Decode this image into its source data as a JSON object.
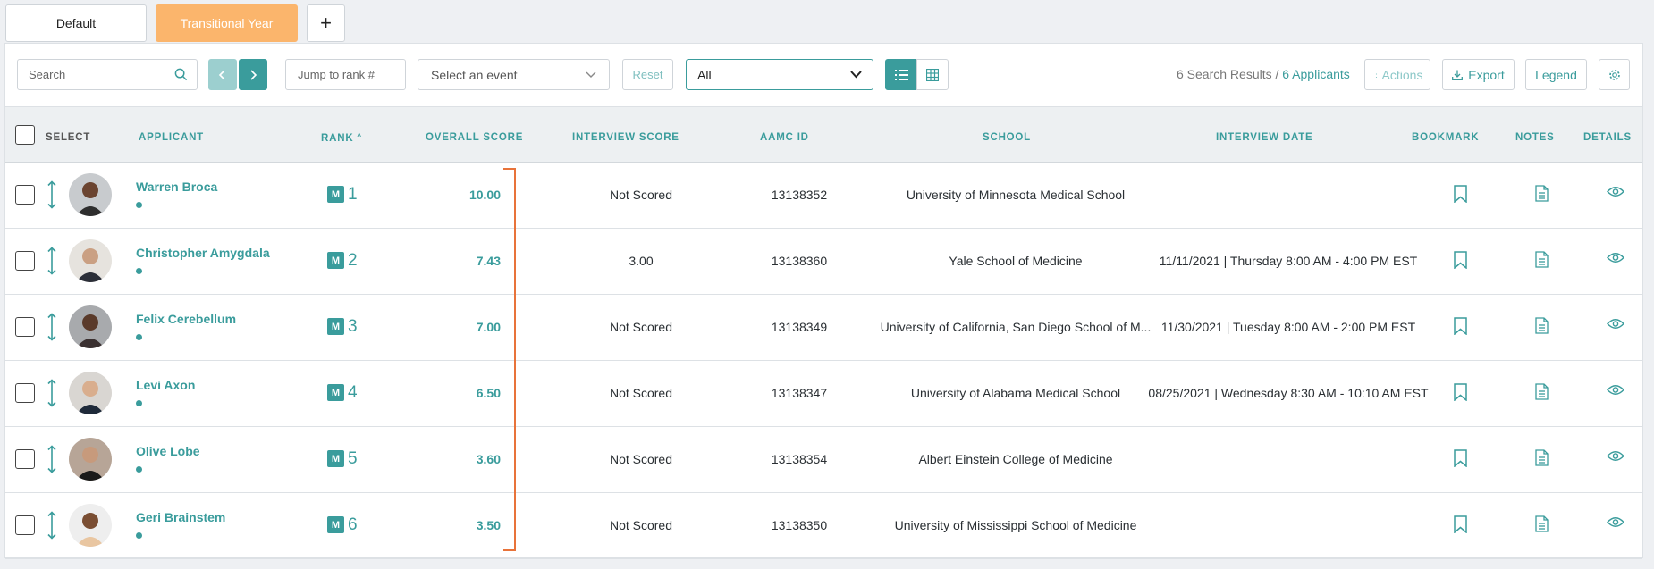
{
  "tabs": [
    {
      "label": "Default"
    },
    {
      "label": "Transitional Year"
    },
    {
      "label": "+"
    }
  ],
  "toolbar": {
    "search_placeholder": "Search",
    "jump_placeholder": "Jump to rank #",
    "event_placeholder": "Select an event",
    "reset_label": "Reset",
    "filter_value": "All",
    "results_count": "6 Search Results",
    "results_sep": " / ",
    "results_applicants": "6 Applicants",
    "actions_label": "Actions",
    "export_label": "Export",
    "legend_label": "Legend"
  },
  "columns": {
    "select": "SELECT",
    "applicant": "APPLICANT",
    "rank": "RANK",
    "overall": "OVERALL SCORE",
    "interview": "INTERVIEW SCORE",
    "aamc": "AAMC ID",
    "school": "SCHOOL",
    "date": "INTERVIEW DATE",
    "bookmark": "BOOKMARK",
    "notes": "NOTES",
    "details": "DETAILS"
  },
  "rows": [
    {
      "name": "Warren Broca",
      "badge": "M",
      "rank": "1",
      "overall": "10.00",
      "interview": "Not Scored",
      "aamc": "13138352",
      "school": "University of Minnesota Medical School",
      "date": ""
    },
    {
      "name": "Christopher Amygdala",
      "badge": "M",
      "rank": "2",
      "overall": "7.43",
      "interview": "3.00",
      "aamc": "13138360",
      "school": "Yale School of Medicine",
      "date": "11/11/2021 | Thursday 8:00 AM - 4:00 PM EST"
    },
    {
      "name": "Felix Cerebellum",
      "badge": "M",
      "rank": "3",
      "overall": "7.00",
      "interview": "Not Scored",
      "aamc": "13138349",
      "school": "University of California, San Diego School of M...",
      "date": "11/30/2021 | Tuesday 8:00 AM - 2:00 PM EST"
    },
    {
      "name": "Levi Axon",
      "badge": "M",
      "rank": "4",
      "overall": "6.50",
      "interview": "Not Scored",
      "aamc": "13138347",
      "school": "University of Alabama Medical School",
      "date": "08/25/2021 | Wednesday 8:30 AM - 10:10 AM EST"
    },
    {
      "name": "Olive Lobe",
      "badge": "M",
      "rank": "5",
      "overall": "3.60",
      "interview": "Not Scored",
      "aamc": "13138354",
      "school": "Albert Einstein College of Medicine",
      "date": ""
    },
    {
      "name": "Geri Brainstem",
      "badge": "M",
      "rank": "6",
      "overall": "3.50",
      "interview": "Not Scored",
      "aamc": "13138350",
      "school": "University of Mississippi School of Medicine",
      "date": ""
    }
  ],
  "colors": {
    "accent": "#3a9c9c",
    "tab_active": "#fbb56c",
    "bracket": "#e8733a"
  }
}
